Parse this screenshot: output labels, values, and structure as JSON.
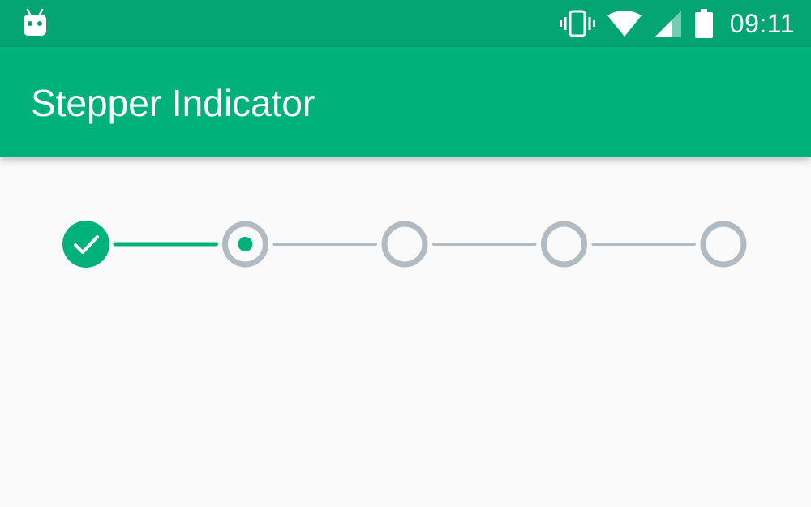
{
  "status_bar": {
    "time": "09:11",
    "icons": [
      "android-icon",
      "vibrate-icon",
      "wifi-icon",
      "signal-icon",
      "battery-icon"
    ]
  },
  "app_bar": {
    "title": "Stepper Indicator"
  },
  "stepper": {
    "step_count": 5,
    "current_step": 2,
    "completed_steps": 1,
    "colors": {
      "accent": "#00b27a",
      "inactive": "#b1bbc1",
      "status_bar": "#03a572",
      "app_bar": "#00b27a",
      "background": "#fafafa"
    },
    "step_states": [
      "completed",
      "current",
      "pending",
      "pending",
      "pending"
    ]
  }
}
